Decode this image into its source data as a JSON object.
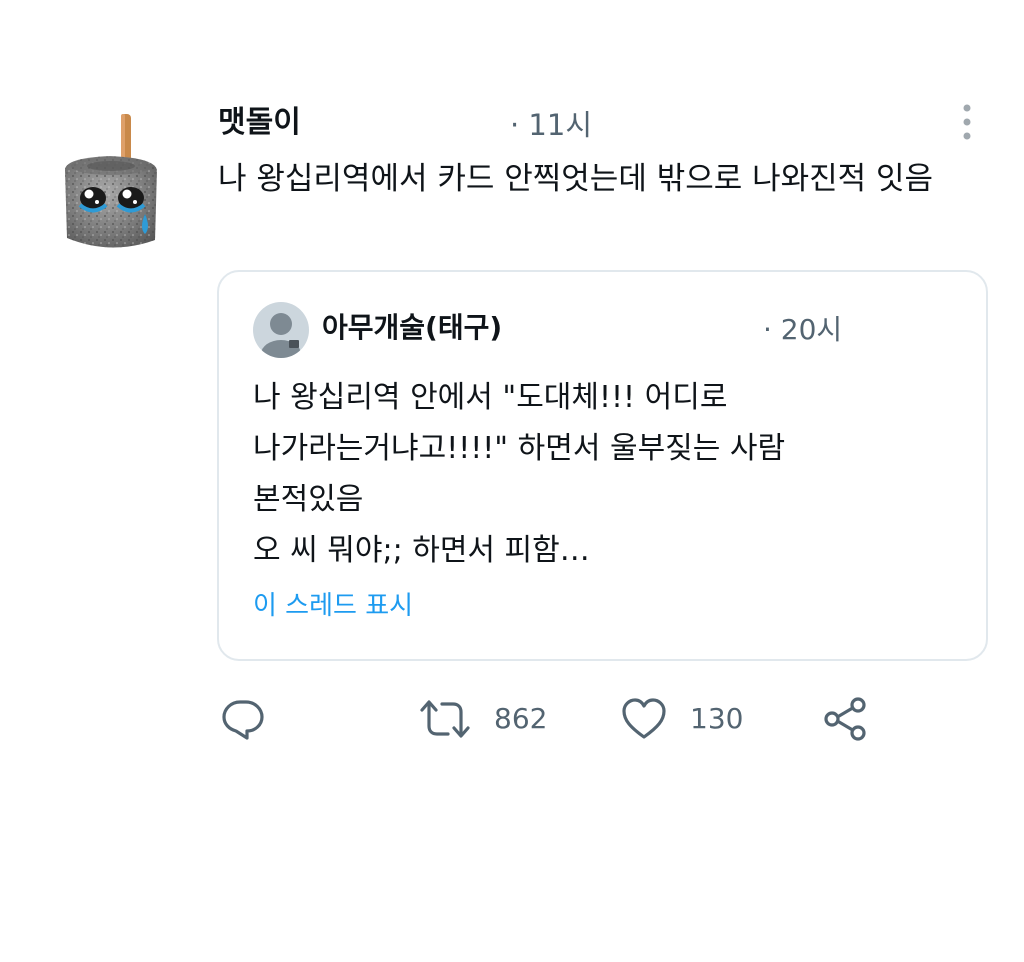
{
  "tweet": {
    "author_name": "맷돌이",
    "time": "· 11시",
    "text": "나 왕십리역에서 카드 안찍엇는데 밖으로 나와진적 잇음",
    "avatar_icon": "millstone-crying-icon",
    "more_icon": "more-vertical-icon"
  },
  "quote": {
    "author_name": "아무개술(태구)",
    "time": "· 20시",
    "lines": [
      "나 왕십리역 안에서 \"도대체!!! 어디로",
      "나가라는거냐고!!!!\" 하면서 울부짖는 사람",
      "본적있음",
      "오 씨 뭐야;; 하면서 피함…"
    ],
    "show_thread": "이 스레드 표시",
    "avatar_icon": "default-profile-icon"
  },
  "actions": {
    "reply_icon": "reply-icon",
    "retweet_icon": "retweet-icon",
    "retweet_count": "862",
    "like_icon": "heart-icon",
    "like_count": "130",
    "share_icon": "share-icon"
  },
  "colors": {
    "text": "#0f1419",
    "secondary": "#536471",
    "link": "#1d9bf0",
    "border": "#e1e8ed"
  }
}
